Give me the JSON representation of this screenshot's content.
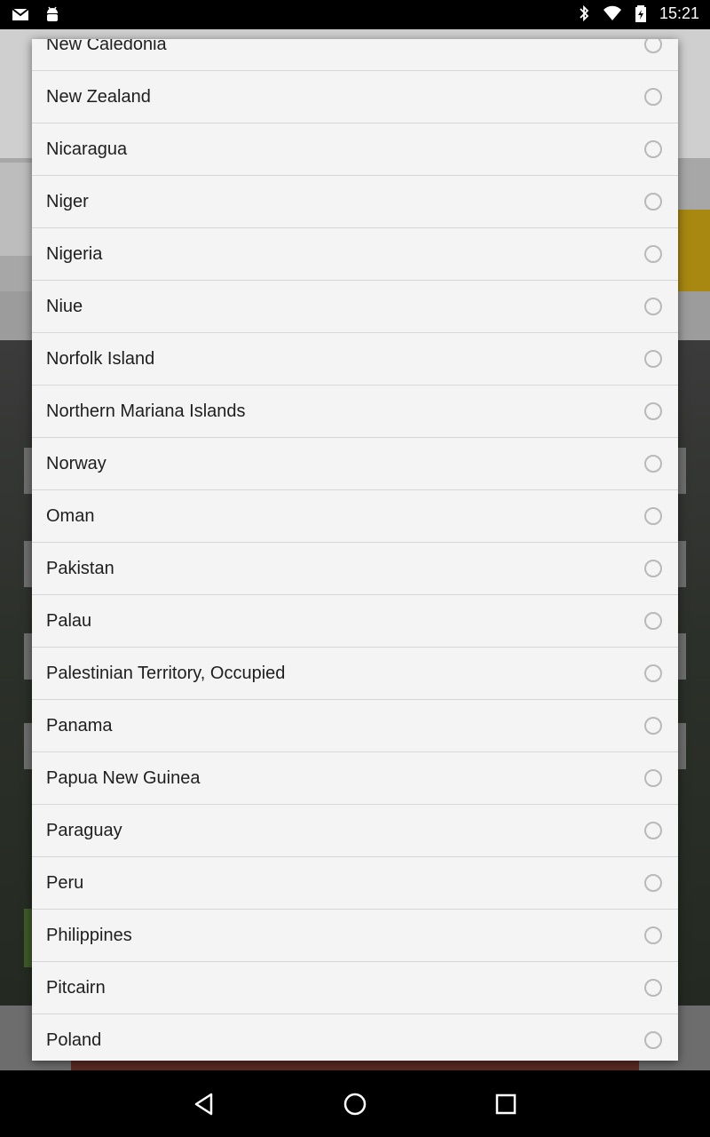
{
  "status_bar": {
    "time": "15:21",
    "left_icons": [
      "gmail-icon",
      "android-icon"
    ],
    "right_icons": [
      "bluetooth-icon",
      "wifi-icon",
      "battery-charging-icon"
    ]
  },
  "dialog": {
    "options": [
      {
        "label": "New Caledonia",
        "selected": false
      },
      {
        "label": "New Zealand",
        "selected": false
      },
      {
        "label": "Nicaragua",
        "selected": false
      },
      {
        "label": "Niger",
        "selected": false
      },
      {
        "label": "Nigeria",
        "selected": false
      },
      {
        "label": "Niue",
        "selected": false
      },
      {
        "label": "Norfolk Island",
        "selected": false
      },
      {
        "label": "Northern Mariana Islands",
        "selected": false
      },
      {
        "label": "Norway",
        "selected": false
      },
      {
        "label": "Oman",
        "selected": false
      },
      {
        "label": "Pakistan",
        "selected": false
      },
      {
        "label": "Palau",
        "selected": false
      },
      {
        "label": "Palestinian Territory, Occupied",
        "selected": false
      },
      {
        "label": "Panama",
        "selected": false
      },
      {
        "label": "Papua New Guinea",
        "selected": false
      },
      {
        "label": "Paraguay",
        "selected": false
      },
      {
        "label": "Peru",
        "selected": false
      },
      {
        "label": "Philippines",
        "selected": false
      },
      {
        "label": "Pitcairn",
        "selected": false
      },
      {
        "label": "Poland",
        "selected": false
      }
    ]
  },
  "nav_bar": {
    "buttons": [
      "back-icon",
      "home-icon",
      "recents-icon"
    ]
  },
  "colors": {
    "dialog_background": "#f4f4f4",
    "divider": "#d6d6d6",
    "radio_border": "#b9b9b9",
    "status_bar": "#000000"
  }
}
